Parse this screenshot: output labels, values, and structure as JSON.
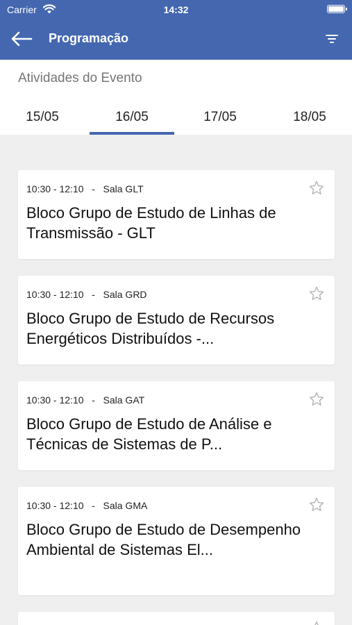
{
  "status_bar": {
    "carrier": "Carrier",
    "time": "14:32"
  },
  "nav": {
    "title": "Programação"
  },
  "section_title": "Atividades do Evento",
  "tabs": [
    {
      "label": "15/05"
    },
    {
      "label": "16/05",
      "active": true
    },
    {
      "label": "17/05"
    },
    {
      "label": "18/05"
    }
  ],
  "activities": [
    {
      "time": "10:30 - 12:10",
      "room": "Sala GLT",
      "title": "Bloco Grupo de Estudo de Linhas de Transmissão - GLT"
    },
    {
      "time": "10:30 - 12:10",
      "room": "Sala GRD",
      "title": "Bloco Grupo de Estudo de Recursos Energéticos Distribuídos -..."
    },
    {
      "time": "10:30 - 12:10",
      "room": "Sala GAT",
      "title": "Bloco Grupo de Estudo de Análise e Técnicas de Sistemas de P..."
    },
    {
      "time": "10:30 - 12:10",
      "room": "Sala GMA",
      "title": "Bloco Grupo de Estudo de Desempenho Ambiental de Sistemas El..."
    }
  ],
  "colors": {
    "header": "#4467b0",
    "tab_indicator": "#4467b0",
    "background": "#efefef"
  }
}
